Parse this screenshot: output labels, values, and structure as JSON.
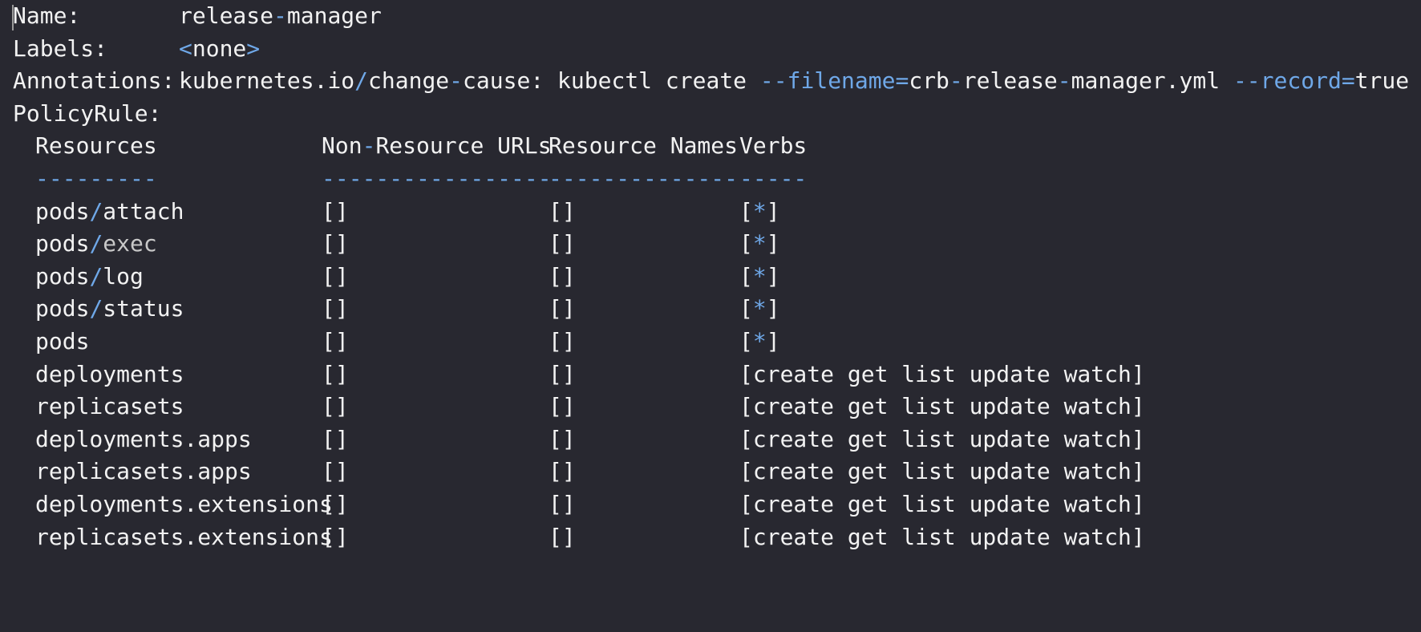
{
  "terminal": {
    "meta": [
      {
        "label": "Name:",
        "value_parts": [
          {
            "t": "release"
          },
          {
            "t": "-",
            "c": "blue"
          },
          {
            "t": "manager"
          }
        ]
      },
      {
        "label": "Labels:",
        "value_parts": [
          {
            "t": "<",
            "c": "blue"
          },
          {
            "t": "none"
          },
          {
            "t": ">",
            "c": "blue"
          }
        ]
      },
      {
        "label": "Annotations:",
        "value_parts": [
          {
            "t": "kubernetes.io"
          },
          {
            "t": "/",
            "c": "blue"
          },
          {
            "t": "change"
          },
          {
            "t": "-",
            "c": "blue"
          },
          {
            "t": "cause: kubectl create "
          },
          {
            "t": "--filename",
            "c": "blue"
          },
          {
            "t": "=",
            "c": "blue"
          },
          {
            "t": "crb"
          },
          {
            "t": "-",
            "c": "blue"
          },
          {
            "t": "release"
          },
          {
            "t": "-",
            "c": "blue"
          },
          {
            "t": "manager.yml "
          },
          {
            "t": "--record",
            "c": "blue"
          },
          {
            "t": "=",
            "c": "blue"
          },
          {
            "t": "true"
          }
        ]
      }
    ],
    "policy_rule_label": "PolicyRule:",
    "table": {
      "headers": [
        [
          {
            "t": "Resources"
          }
        ],
        [
          {
            "t": "Non"
          },
          {
            "t": "-",
            "c": "blue"
          },
          {
            "t": "Resource URLs"
          }
        ],
        [
          {
            "t": "Resource Names"
          }
        ],
        [
          {
            "t": "Verbs"
          }
        ]
      ],
      "separators": [
        "---------",
        "-----------------",
        "--------------",
        "-----"
      ],
      "rows": [
        {
          "resource": [
            {
              "t": "pods"
            },
            {
              "t": "/",
              "c": "blue"
            },
            {
              "t": "attach"
            }
          ],
          "urls": "[]",
          "names": "[]",
          "verbs": [
            {
              "t": "["
            },
            {
              "t": "*",
              "c": "blue"
            },
            {
              "t": "]"
            }
          ]
        },
        {
          "resource": [
            {
              "t": "pods"
            },
            {
              "t": "/",
              "c": "blue"
            },
            {
              "t": "exec",
              "c": "grey"
            }
          ],
          "urls": "[]",
          "names": "[]",
          "verbs": [
            {
              "t": "["
            },
            {
              "t": "*",
              "c": "blue"
            },
            {
              "t": "]"
            }
          ]
        },
        {
          "resource": [
            {
              "t": "pods"
            },
            {
              "t": "/",
              "c": "blue"
            },
            {
              "t": "log"
            }
          ],
          "urls": "[]",
          "names": "[]",
          "verbs": [
            {
              "t": "["
            },
            {
              "t": "*",
              "c": "blue"
            },
            {
              "t": "]"
            }
          ]
        },
        {
          "resource": [
            {
              "t": "pods"
            },
            {
              "t": "/",
              "c": "blue"
            },
            {
              "t": "status"
            }
          ],
          "urls": "[]",
          "names": "[]",
          "verbs": [
            {
              "t": "["
            },
            {
              "t": "*",
              "c": "blue"
            },
            {
              "t": "]"
            }
          ]
        },
        {
          "resource": [
            {
              "t": "pods"
            }
          ],
          "urls": "[]",
          "names": "[]",
          "verbs": [
            {
              "t": "["
            },
            {
              "t": "*",
              "c": "blue"
            },
            {
              "t": "]"
            }
          ]
        },
        {
          "resource": [
            {
              "t": "deployments"
            }
          ],
          "urls": "[]",
          "names": "[]",
          "verbs": [
            {
              "t": "[create get list update watch]"
            }
          ]
        },
        {
          "resource": [
            {
              "t": "replicasets"
            }
          ],
          "urls": "[]",
          "names": "[]",
          "verbs": [
            {
              "t": "[create get list update watch]"
            }
          ]
        },
        {
          "resource": [
            {
              "t": "deployments.apps"
            }
          ],
          "urls": "[]",
          "names": "[]",
          "verbs": [
            {
              "t": "[create get list update watch]"
            }
          ]
        },
        {
          "resource": [
            {
              "t": "replicasets.apps"
            }
          ],
          "urls": "[]",
          "names": "[]",
          "verbs": [
            {
              "t": "[create get list update watch]"
            }
          ]
        },
        {
          "resource": [
            {
              "t": "deployments.extensions"
            }
          ],
          "urls": "[]",
          "names": "[]",
          "verbs": [
            {
              "t": "[create get list update watch]"
            }
          ]
        },
        {
          "resource": [
            {
              "t": "replicasets.extensions"
            }
          ],
          "urls": "[]",
          "names": "[]",
          "verbs": [
            {
              "t": "[create get list update watch]"
            }
          ]
        }
      ]
    }
  },
  "colors": {
    "background": "#282830",
    "text": "#f2f2f2",
    "accent_blue": "#6fa8e8",
    "dim_text": "#c8c8c8"
  }
}
